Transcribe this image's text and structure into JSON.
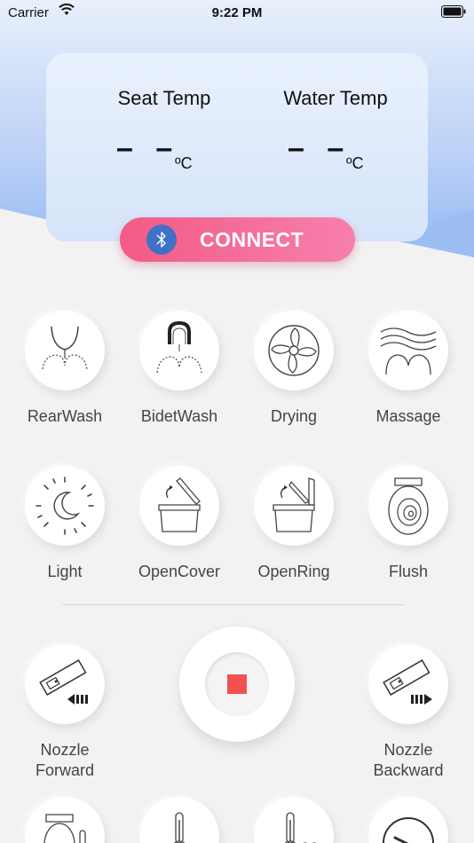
{
  "status_bar": {
    "carrier": "Carrier",
    "time": "9:22 PM"
  },
  "temps": {
    "seat": {
      "label": "Seat Temp",
      "value": "– –",
      "unit": "ºC"
    },
    "water": {
      "label": "Water Temp",
      "value": "– –",
      "unit": "ºC"
    }
  },
  "connect": {
    "label": "CONNECT",
    "icon": "bluetooth-icon"
  },
  "functions_row1": [
    {
      "label": "RearWash",
      "icon": "rear-wash-icon"
    },
    {
      "label": "BidetWash",
      "icon": "bidet-wash-icon"
    },
    {
      "label": "Drying",
      "icon": "fan-icon"
    },
    {
      "label": "Massage",
      "icon": "massage-icon"
    }
  ],
  "functions_row2": [
    {
      "label": "Light",
      "icon": "moon-light-icon"
    },
    {
      "label": "OpenCover",
      "icon": "open-cover-icon"
    },
    {
      "label": "OpenRing",
      "icon": "open-ring-icon"
    },
    {
      "label": "Flush",
      "icon": "flush-icon"
    }
  ],
  "nozzle": {
    "forward": {
      "label_line1": "Nozzle",
      "label_line2": "Forward"
    },
    "backward": {
      "label_line1": "Nozzle",
      "label_line2": "Backward"
    },
    "stop_icon": "stop-icon"
  },
  "colors": {
    "accent": "#f25b85",
    "bluetooth": "#3f71c9",
    "stop": "#f35050"
  }
}
